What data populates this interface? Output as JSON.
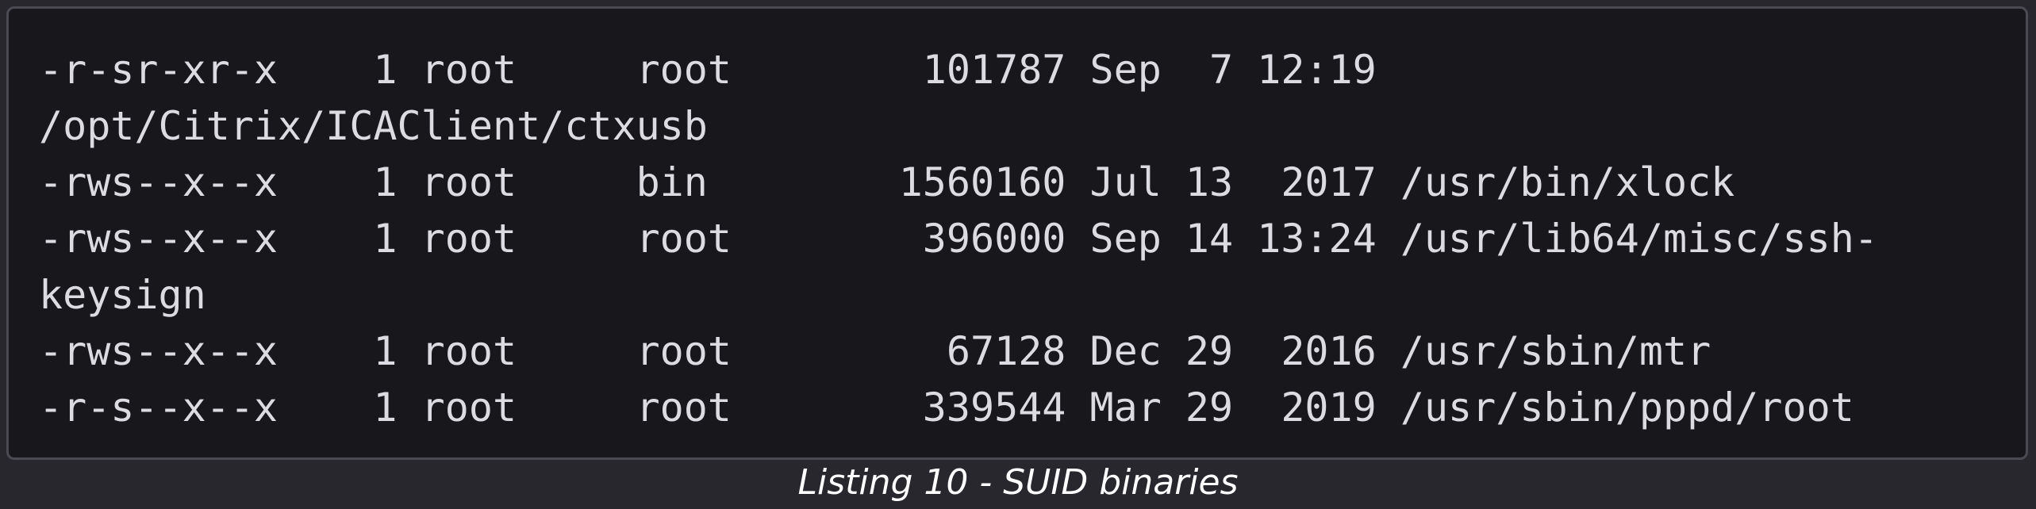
{
  "listing": {
    "lines": [
      "-r-sr-xr-x    1 root     root        101787 Sep  7 12:19",
      "/opt/Citrix/ICAClient/ctxusb",
      "-rws--x--x    1 root     bin        1560160 Jul 13  2017 /usr/bin/xlock",
      "-rws--x--x    1 root     root        396000 Sep 14 13:24 /usr/lib64/misc/ssh-",
      "keysign",
      "-rws--x--x    1 root     root         67128 Dec 29  2016 /usr/sbin/mtr",
      "-r-s--x--x    1 root     root        339544 Mar 29  2019 /usr/sbin/pppd/root"
    ],
    "caption": "Listing 10 - SUID binaries"
  }
}
